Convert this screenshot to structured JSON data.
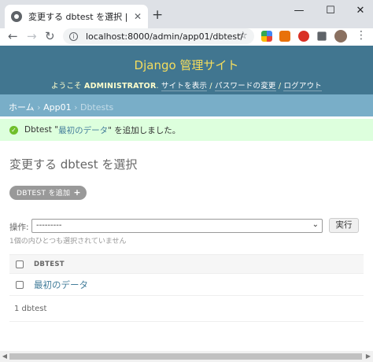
{
  "browser": {
    "tab_title": "変更する dbtest を選択 | Django サイト管理",
    "tab_close": "✕",
    "new_tab": "+",
    "window_minimize": "—",
    "window_maximize": "☐",
    "window_close": "✕",
    "back": "←",
    "forward": "→",
    "reload": "↻",
    "url": "localhost:8000/admin/app01/dbtest/",
    "info_icon": "i",
    "star": "☆",
    "menu": "⋮"
  },
  "header": {
    "branding": "Django 管理サイト",
    "welcome": "ようこそ",
    "username": "ADMINISTRATOR",
    "links": [
      "サイトを表示",
      "パスワードの変更",
      "ログアウト"
    ],
    "sep": "/"
  },
  "breadcrumbs": {
    "home": "ホーム",
    "app": "App01",
    "current": "Dbtests",
    "sep": "›"
  },
  "message": {
    "prefix": "Dbtest \"",
    "object": "最初のデータ",
    "suffix": "\" を追加しました。",
    "icon": "✓"
  },
  "content_title": "変更する dbtest を選択",
  "add_button": {
    "label": "DBTEST を追加",
    "icon": "+"
  },
  "actions": {
    "label": "操作:",
    "selected": "---------",
    "chevron": "⌄",
    "go": "実行",
    "counter": "1個の内ひとつも選択されていません"
  },
  "table": {
    "column": "DBTEST",
    "rows": [
      "最初のデータ"
    ]
  },
  "paginator": "1 dbtest",
  "colors": {
    "header_bg": "#417690",
    "branding": "#f5dd5d",
    "breadcrumbs_bg": "#79aec8",
    "success_bg": "#ddffdd",
    "link": "#447e9b"
  }
}
